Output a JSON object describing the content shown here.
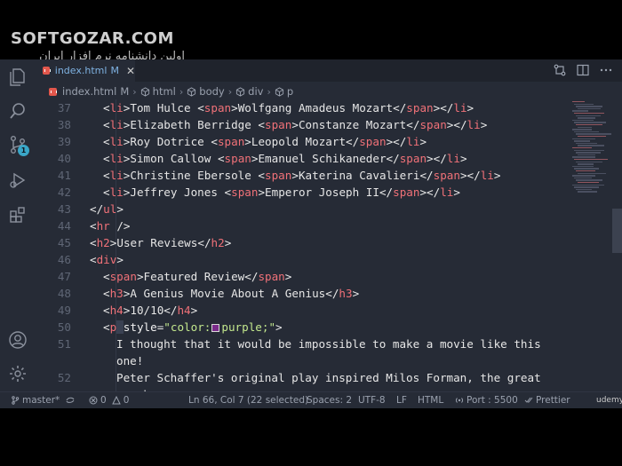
{
  "watermark": {
    "title": "SOFTGOZAR.COM",
    "subtitle": "اولین دانشنامه نرم افزار ایران"
  },
  "tab": {
    "label": "index.html",
    "modified": "M",
    "close": "✕"
  },
  "breadcrumb": {
    "file": "index.html",
    "file_mod": "M",
    "items": [
      "html",
      "body",
      "div",
      "p"
    ]
  },
  "editor": {
    "lines": [
      {
        "n": "37",
        "indent": 1,
        "tokens": [
          [
            "br",
            "<"
          ],
          [
            "tag",
            "li"
          ],
          [
            "br",
            ">"
          ],
          [
            "txt",
            "Tom Hulce "
          ],
          [
            "br",
            "<"
          ],
          [
            "tag",
            "span"
          ],
          [
            "br",
            ">"
          ],
          [
            "txt",
            "Wolfgang Amadeus Mozart"
          ],
          [
            "br",
            "</"
          ],
          [
            "tag",
            "span"
          ],
          [
            "br",
            "></"
          ],
          [
            "tag",
            "li"
          ],
          [
            "br",
            ">"
          ]
        ]
      },
      {
        "n": "38",
        "indent": 1,
        "tokens": [
          [
            "br",
            "<"
          ],
          [
            "tag",
            "li"
          ],
          [
            "br",
            ">"
          ],
          [
            "txt",
            "Elizabeth Berridge "
          ],
          [
            "br",
            "<"
          ],
          [
            "tag",
            "span"
          ],
          [
            "br",
            ">"
          ],
          [
            "txt",
            "Constanze Mozart"
          ],
          [
            "br",
            "</"
          ],
          [
            "tag",
            "span"
          ],
          [
            "br",
            "></"
          ],
          [
            "tag",
            "li"
          ],
          [
            "br",
            ">"
          ]
        ]
      },
      {
        "n": "39",
        "indent": 1,
        "tokens": [
          [
            "br",
            "<"
          ],
          [
            "tag",
            "li"
          ],
          [
            "br",
            ">"
          ],
          [
            "txt",
            "Roy Dotrice "
          ],
          [
            "br",
            "<"
          ],
          [
            "tag",
            "span"
          ],
          [
            "br",
            ">"
          ],
          [
            "txt",
            "Leopold Mozart"
          ],
          [
            "br",
            "</"
          ],
          [
            "tag",
            "span"
          ],
          [
            "br",
            "></"
          ],
          [
            "tag",
            "li"
          ],
          [
            "br",
            ">"
          ]
        ]
      },
      {
        "n": "40",
        "indent": 1,
        "tokens": [
          [
            "br",
            "<"
          ],
          [
            "tag",
            "li"
          ],
          [
            "br",
            ">"
          ],
          [
            "txt",
            "Simon Callow "
          ],
          [
            "br",
            "<"
          ],
          [
            "tag",
            "span"
          ],
          [
            "br",
            ">"
          ],
          [
            "txt",
            "Emanuel Schikaneder"
          ],
          [
            "br",
            "</"
          ],
          [
            "tag",
            "span"
          ],
          [
            "br",
            "></"
          ],
          [
            "tag",
            "li"
          ],
          [
            "br",
            ">"
          ]
        ]
      },
      {
        "n": "41",
        "indent": 1,
        "tokens": [
          [
            "br",
            "<"
          ],
          [
            "tag",
            "li"
          ],
          [
            "br",
            ">"
          ],
          [
            "txt",
            "Christine Ebersole "
          ],
          [
            "br",
            "<"
          ],
          [
            "tag",
            "span"
          ],
          [
            "br",
            ">"
          ],
          [
            "txt",
            "Katerina Cavalieri"
          ],
          [
            "br",
            "</"
          ],
          [
            "tag",
            "span"
          ],
          [
            "br",
            "></"
          ],
          [
            "tag",
            "li"
          ],
          [
            "br",
            ">"
          ]
        ]
      },
      {
        "n": "42",
        "indent": 1,
        "tokens": [
          [
            "br",
            "<"
          ],
          [
            "tag",
            "li"
          ],
          [
            "br",
            ">"
          ],
          [
            "txt",
            "Jeffrey Jones "
          ],
          [
            "br",
            "<"
          ],
          [
            "tag",
            "span"
          ],
          [
            "br",
            ">"
          ],
          [
            "txt",
            "Emperor Joseph II"
          ],
          [
            "br",
            "</"
          ],
          [
            "tag",
            "span"
          ],
          [
            "br",
            "></"
          ],
          [
            "tag",
            "li"
          ],
          [
            "br",
            ">"
          ]
        ]
      },
      {
        "n": "43",
        "indent": 0,
        "tokens": [
          [
            "br",
            "</"
          ],
          [
            "tag",
            "ul"
          ],
          [
            "br",
            ">"
          ]
        ]
      },
      {
        "n": "44",
        "indent": 0,
        "tokens": [
          [
            "br",
            "<"
          ],
          [
            "tag",
            "hr"
          ],
          [
            "br",
            " />"
          ]
        ]
      },
      {
        "n": "45",
        "indent": 0,
        "tokens": [
          [
            "br",
            "<"
          ],
          [
            "tag",
            "h2"
          ],
          [
            "br",
            ">"
          ],
          [
            "txt",
            "User Reviews"
          ],
          [
            "br",
            "</"
          ],
          [
            "tag",
            "h2"
          ],
          [
            "br",
            ">"
          ]
        ]
      },
      {
        "n": "46",
        "indent": 0,
        "tokens": [
          [
            "br",
            "<"
          ],
          [
            "tag",
            "div"
          ],
          [
            "br",
            ">"
          ]
        ]
      },
      {
        "n": "47",
        "indent": 1,
        "tokens": [
          [
            "br",
            "<"
          ],
          [
            "tag",
            "span"
          ],
          [
            "br",
            ">"
          ],
          [
            "txt",
            "Featured Review"
          ],
          [
            "br",
            "</"
          ],
          [
            "tag",
            "span"
          ],
          [
            "br",
            ">"
          ]
        ]
      },
      {
        "n": "48",
        "indent": 1,
        "tokens": [
          [
            "br",
            "<"
          ],
          [
            "tag",
            "h3"
          ],
          [
            "br",
            ">"
          ],
          [
            "txt",
            "A Genius Movie About A Genius"
          ],
          [
            "br",
            "</"
          ],
          [
            "tag",
            "h3"
          ],
          [
            "br",
            ">"
          ]
        ]
      },
      {
        "n": "49",
        "indent": 1,
        "tokens": [
          [
            "br",
            "<"
          ],
          [
            "tag",
            "h4"
          ],
          [
            "br",
            ">"
          ],
          [
            "txt",
            "10/10"
          ],
          [
            "br",
            "</"
          ],
          [
            "tag",
            "h4"
          ],
          [
            "br",
            ">"
          ]
        ]
      },
      {
        "n": "50",
        "indent": 1,
        "tokens": [
          [
            "br",
            "<"
          ],
          [
            "tag",
            "p"
          ],
          [
            "sel",
            " "
          ],
          [
            "attr",
            "style"
          ],
          [
            "br",
            "="
          ],
          [
            "str",
            "\"color:"
          ],
          [
            "swatch",
            ""
          ],
          [
            "str",
            "purple;\""
          ],
          [
            "br",
            ">"
          ]
        ]
      },
      {
        "n": "51",
        "indent": 2,
        "tokens": [
          [
            "txt",
            "I thought that it would be impossible to make a movie like this"
          ]
        ]
      },
      {
        "n": "",
        "indent": 2,
        "tokens": [
          [
            "txt",
            "one!"
          ]
        ]
      },
      {
        "n": "52",
        "indent": 2,
        "tokens": [
          [
            "txt",
            "Peter Schaffer's original play inspired Milos Forman, the great"
          ]
        ]
      },
      {
        "n": "",
        "indent": 2,
        "tokens": [
          [
            "txt",
            "czech"
          ]
        ]
      }
    ]
  },
  "statusbar": {
    "branch": "master*",
    "errors": "0",
    "warnings": "0",
    "position": "Ln 66, Col 7 (22 selected)",
    "spaces": "Spaces: 2",
    "encoding": "UTF-8",
    "eol": "LF",
    "language": "HTML",
    "port": "Port : 5500",
    "formatter": "Prettier",
    "udemy": "udemy"
  },
  "activity": {
    "icons": [
      "explorer-icon",
      "search-icon",
      "source-control-icon",
      "run-debug-icon",
      "extensions-icon",
      "account-icon",
      "settings-icon"
    ],
    "scm_badge": "1"
  },
  "colors": {
    "editor_bg": "#262b36",
    "tag": "#f07178",
    "string": "#c3e88d",
    "accent": "#3aa6c7"
  }
}
